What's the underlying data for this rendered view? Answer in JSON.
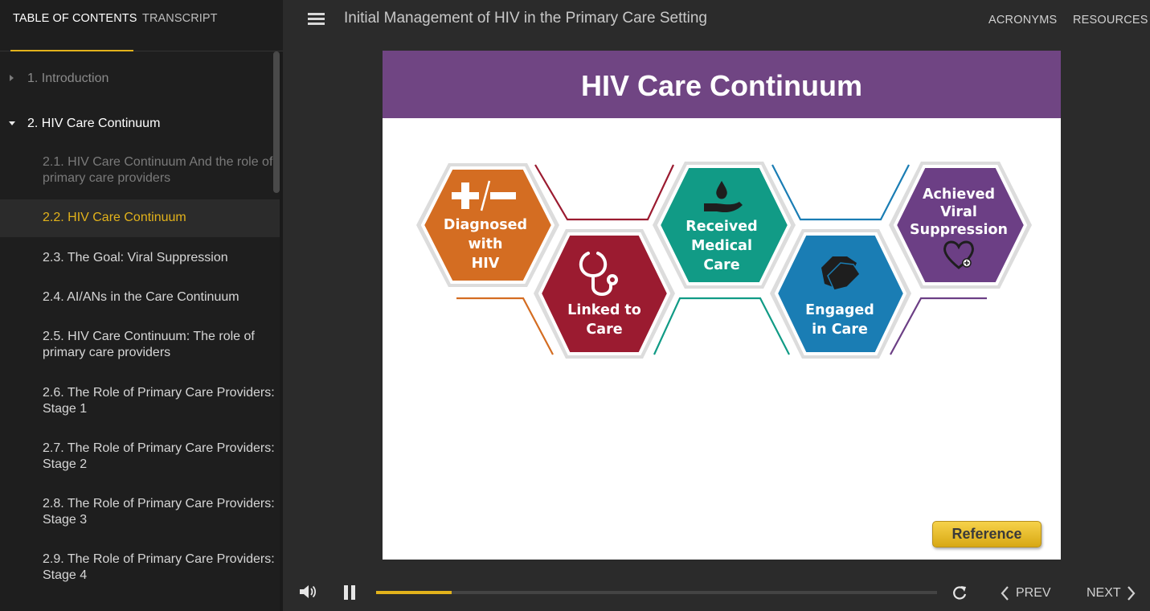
{
  "sidebar": {
    "tabs": [
      {
        "label": "TABLE OF CONTENTS",
        "active": true
      },
      {
        "label": "TRANSCRIPT",
        "active": false
      }
    ],
    "toc": [
      {
        "label": "1. Introduction",
        "level": 1,
        "expanded": false,
        "state": "dim"
      },
      {
        "label": "2. HIV Care Continuum",
        "level": 1,
        "expanded": true,
        "state": "bright"
      },
      {
        "label": "2.1. HIV Care Continuum And the role of\nprimary care providers",
        "level": 2,
        "state": "dim"
      },
      {
        "label": "2.2. HIV Care Continuum",
        "level": 2,
        "state": "selected"
      },
      {
        "label": "2.3. The Goal: Viral Suppression",
        "level": 2,
        "state": "normal"
      },
      {
        "label": "2.4. AI/ANs in the Care Continuum",
        "level": 2,
        "state": "normal"
      },
      {
        "label": "2.5. HIV Care Continuum: The role of\nprimary care providers",
        "level": 2,
        "state": "normal"
      },
      {
        "label": "2.6. The Role of Primary Care Providers:\nStage 1",
        "level": 2,
        "state": "normal"
      },
      {
        "label": "2.7. The Role of Primary Care Providers:\nStage 2",
        "level": 2,
        "state": "normal"
      },
      {
        "label": "2.8. The Role of Primary Care Providers:\nStage 3",
        "level": 2,
        "state": "normal"
      },
      {
        "label": "2.9. The Role of Primary Care Providers:\nStage 4",
        "level": 2,
        "state": "normal"
      }
    ]
  },
  "header": {
    "course_title": "Initial Management of HIV in the Primary Care Setting",
    "links": {
      "acronyms": "ACRONYMS",
      "resources": "RESOURCES"
    }
  },
  "slide": {
    "title": "HIV Care Continuum",
    "stages": [
      {
        "lines": [
          "Diagnosed",
          "with",
          "HIV"
        ],
        "color": "#d46d22",
        "icon": "plus-minus-icon"
      },
      {
        "lines": [
          "Linked to",
          "Care"
        ],
        "color": "#9b1b30",
        "icon": "stethoscope-icon"
      },
      {
        "lines": [
          "Received",
          "Medical",
          "Care"
        ],
        "color": "#119b86",
        "icon": "hand-drop-icon"
      },
      {
        "lines": [
          "Engaged",
          "in Care"
        ],
        "color": "#1a7db4",
        "icon": "handshake-icon"
      },
      {
        "lines": [
          "Achieved",
          "Viral",
          "Suppression"
        ],
        "color": "#6c3f85",
        "icon": "heart-plus-icon"
      }
    ],
    "reference_label": "Reference",
    "banner_color": "#704583"
  },
  "player": {
    "progress": 0.135,
    "prev_label": "PREV",
    "next_label": "NEXT",
    "accent": "#e2b21b"
  }
}
